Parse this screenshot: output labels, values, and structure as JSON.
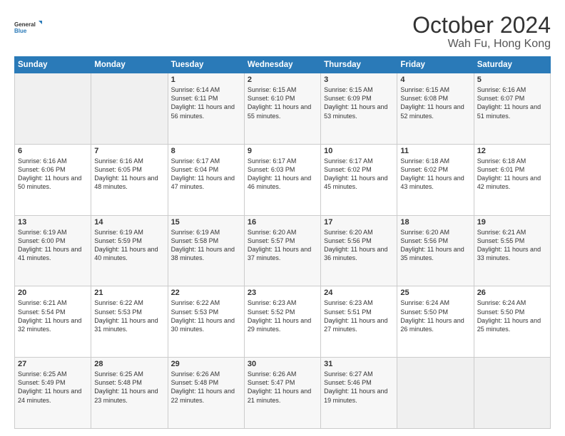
{
  "header": {
    "logo_line1": "General",
    "logo_line2": "Blue",
    "title": "October 2024",
    "subtitle": "Wah Fu, Hong Kong"
  },
  "days_of_week": [
    "Sunday",
    "Monday",
    "Tuesday",
    "Wednesday",
    "Thursday",
    "Friday",
    "Saturday"
  ],
  "weeks": [
    [
      {
        "day": "",
        "sunrise": "",
        "sunset": "",
        "daylight": ""
      },
      {
        "day": "",
        "sunrise": "",
        "sunset": "",
        "daylight": ""
      },
      {
        "day": "1",
        "sunrise": "Sunrise: 6:14 AM",
        "sunset": "Sunset: 6:11 PM",
        "daylight": "Daylight: 11 hours and 56 minutes."
      },
      {
        "day": "2",
        "sunrise": "Sunrise: 6:15 AM",
        "sunset": "Sunset: 6:10 PM",
        "daylight": "Daylight: 11 hours and 55 minutes."
      },
      {
        "day": "3",
        "sunrise": "Sunrise: 6:15 AM",
        "sunset": "Sunset: 6:09 PM",
        "daylight": "Daylight: 11 hours and 53 minutes."
      },
      {
        "day": "4",
        "sunrise": "Sunrise: 6:15 AM",
        "sunset": "Sunset: 6:08 PM",
        "daylight": "Daylight: 11 hours and 52 minutes."
      },
      {
        "day": "5",
        "sunrise": "Sunrise: 6:16 AM",
        "sunset": "Sunset: 6:07 PM",
        "daylight": "Daylight: 11 hours and 51 minutes."
      }
    ],
    [
      {
        "day": "6",
        "sunrise": "Sunrise: 6:16 AM",
        "sunset": "Sunset: 6:06 PM",
        "daylight": "Daylight: 11 hours and 50 minutes."
      },
      {
        "day": "7",
        "sunrise": "Sunrise: 6:16 AM",
        "sunset": "Sunset: 6:05 PM",
        "daylight": "Daylight: 11 hours and 48 minutes."
      },
      {
        "day": "8",
        "sunrise": "Sunrise: 6:17 AM",
        "sunset": "Sunset: 6:04 PM",
        "daylight": "Daylight: 11 hours and 47 minutes."
      },
      {
        "day": "9",
        "sunrise": "Sunrise: 6:17 AM",
        "sunset": "Sunset: 6:03 PM",
        "daylight": "Daylight: 11 hours and 46 minutes."
      },
      {
        "day": "10",
        "sunrise": "Sunrise: 6:17 AM",
        "sunset": "Sunset: 6:02 PM",
        "daylight": "Daylight: 11 hours and 45 minutes."
      },
      {
        "day": "11",
        "sunrise": "Sunrise: 6:18 AM",
        "sunset": "Sunset: 6:02 PM",
        "daylight": "Daylight: 11 hours and 43 minutes."
      },
      {
        "day": "12",
        "sunrise": "Sunrise: 6:18 AM",
        "sunset": "Sunset: 6:01 PM",
        "daylight": "Daylight: 11 hours and 42 minutes."
      }
    ],
    [
      {
        "day": "13",
        "sunrise": "Sunrise: 6:19 AM",
        "sunset": "Sunset: 6:00 PM",
        "daylight": "Daylight: 11 hours and 41 minutes."
      },
      {
        "day": "14",
        "sunrise": "Sunrise: 6:19 AM",
        "sunset": "Sunset: 5:59 PM",
        "daylight": "Daylight: 11 hours and 40 minutes."
      },
      {
        "day": "15",
        "sunrise": "Sunrise: 6:19 AM",
        "sunset": "Sunset: 5:58 PM",
        "daylight": "Daylight: 11 hours and 38 minutes."
      },
      {
        "day": "16",
        "sunrise": "Sunrise: 6:20 AM",
        "sunset": "Sunset: 5:57 PM",
        "daylight": "Daylight: 11 hours and 37 minutes."
      },
      {
        "day": "17",
        "sunrise": "Sunrise: 6:20 AM",
        "sunset": "Sunset: 5:56 PM",
        "daylight": "Daylight: 11 hours and 36 minutes."
      },
      {
        "day": "18",
        "sunrise": "Sunrise: 6:20 AM",
        "sunset": "Sunset: 5:56 PM",
        "daylight": "Daylight: 11 hours and 35 minutes."
      },
      {
        "day": "19",
        "sunrise": "Sunrise: 6:21 AM",
        "sunset": "Sunset: 5:55 PM",
        "daylight": "Daylight: 11 hours and 33 minutes."
      }
    ],
    [
      {
        "day": "20",
        "sunrise": "Sunrise: 6:21 AM",
        "sunset": "Sunset: 5:54 PM",
        "daylight": "Daylight: 11 hours and 32 minutes."
      },
      {
        "day": "21",
        "sunrise": "Sunrise: 6:22 AM",
        "sunset": "Sunset: 5:53 PM",
        "daylight": "Daylight: 11 hours and 31 minutes."
      },
      {
        "day": "22",
        "sunrise": "Sunrise: 6:22 AM",
        "sunset": "Sunset: 5:53 PM",
        "daylight": "Daylight: 11 hours and 30 minutes."
      },
      {
        "day": "23",
        "sunrise": "Sunrise: 6:23 AM",
        "sunset": "Sunset: 5:52 PM",
        "daylight": "Daylight: 11 hours and 29 minutes."
      },
      {
        "day": "24",
        "sunrise": "Sunrise: 6:23 AM",
        "sunset": "Sunset: 5:51 PM",
        "daylight": "Daylight: 11 hours and 27 minutes."
      },
      {
        "day": "25",
        "sunrise": "Sunrise: 6:24 AM",
        "sunset": "Sunset: 5:50 PM",
        "daylight": "Daylight: 11 hours and 26 minutes."
      },
      {
        "day": "26",
        "sunrise": "Sunrise: 6:24 AM",
        "sunset": "Sunset: 5:50 PM",
        "daylight": "Daylight: 11 hours and 25 minutes."
      }
    ],
    [
      {
        "day": "27",
        "sunrise": "Sunrise: 6:25 AM",
        "sunset": "Sunset: 5:49 PM",
        "daylight": "Daylight: 11 hours and 24 minutes."
      },
      {
        "day": "28",
        "sunrise": "Sunrise: 6:25 AM",
        "sunset": "Sunset: 5:48 PM",
        "daylight": "Daylight: 11 hours and 23 minutes."
      },
      {
        "day": "29",
        "sunrise": "Sunrise: 6:26 AM",
        "sunset": "Sunset: 5:48 PM",
        "daylight": "Daylight: 11 hours and 22 minutes."
      },
      {
        "day": "30",
        "sunrise": "Sunrise: 6:26 AM",
        "sunset": "Sunset: 5:47 PM",
        "daylight": "Daylight: 11 hours and 21 minutes."
      },
      {
        "day": "31",
        "sunrise": "Sunrise: 6:27 AM",
        "sunset": "Sunset: 5:46 PM",
        "daylight": "Daylight: 11 hours and 19 minutes."
      },
      {
        "day": "",
        "sunrise": "",
        "sunset": "",
        "daylight": ""
      },
      {
        "day": "",
        "sunrise": "",
        "sunset": "",
        "daylight": ""
      }
    ]
  ]
}
